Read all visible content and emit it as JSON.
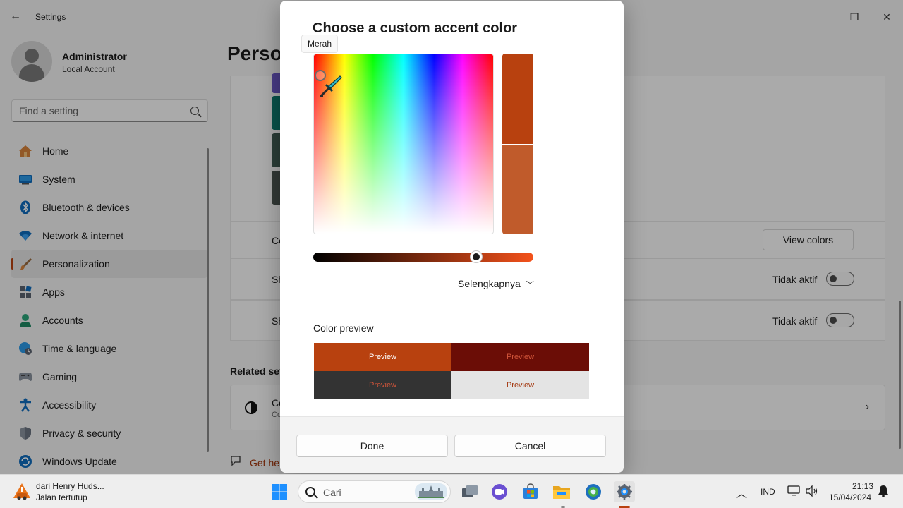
{
  "window": {
    "app_title": "Settings",
    "back_glyph": "←",
    "min_glyph": "—",
    "max_glyph": "❐",
    "close_glyph": "✕"
  },
  "profile": {
    "name": "Administrator",
    "account_type": "Local Account"
  },
  "search": {
    "placeholder": "Find a setting"
  },
  "sidebar": {
    "items": [
      {
        "label": "Home",
        "icon": "home-icon"
      },
      {
        "label": "System",
        "icon": "monitor-icon"
      },
      {
        "label": "Bluetooth & devices",
        "icon": "bluetooth-icon"
      },
      {
        "label": "Network & internet",
        "icon": "wifi-icon"
      },
      {
        "label": "Personalization",
        "icon": "brush-icon",
        "active": true
      },
      {
        "label": "Apps",
        "icon": "apps-icon"
      },
      {
        "label": "Accounts",
        "icon": "person-icon"
      },
      {
        "label": "Time & language",
        "icon": "globe-clock-icon"
      },
      {
        "label": "Gaming",
        "icon": "gamepad-icon"
      },
      {
        "label": "Accessibility",
        "icon": "accessibility-icon"
      },
      {
        "label": "Privacy & security",
        "icon": "shield-icon"
      },
      {
        "label": "Windows Update",
        "icon": "update-icon"
      }
    ]
  },
  "main": {
    "page_title": "Perso",
    "rows": [
      {
        "label": "Co"
      },
      {
        "label": "Sh",
        "state": "Tidak aktif"
      },
      {
        "label": "Sh",
        "state": "Tidak aktif"
      }
    ],
    "view_colors_label": "View colors",
    "related_heading": "Related set",
    "related_item": {
      "title": "Co",
      "subtitle": "Co"
    },
    "get_help": "Get he"
  },
  "dialog": {
    "title": "Choose a custom accent color",
    "tooltip": "Merah",
    "selected_color": "#b8410f",
    "previous_color": "#c05b2b",
    "value_level": 0.74,
    "more_label": "Selengkapnya",
    "preview_heading": "Color preview",
    "preview_cells": [
      {
        "label": "Preview",
        "bg": "#b8410f",
        "fg": "#ffffff"
      },
      {
        "label": "Preview",
        "bg": "#6b0d06",
        "fg": "#d2553a"
      },
      {
        "label": "Preview",
        "bg": "#333333",
        "fg": "#d2553a"
      },
      {
        "label": "Preview",
        "bg": "#e4e4e4",
        "fg": "#a3360d"
      }
    ],
    "done_label": "Done",
    "cancel_label": "Cancel"
  },
  "taskbar": {
    "weather_title": "dari Henry Huds...",
    "weather_subtitle": "Jalan tertutup",
    "search_placeholder": "Cari",
    "language": "IND",
    "time": "21:13",
    "date": "15/04/2024"
  },
  "colors": {
    "accent": "#b8410f"
  }
}
